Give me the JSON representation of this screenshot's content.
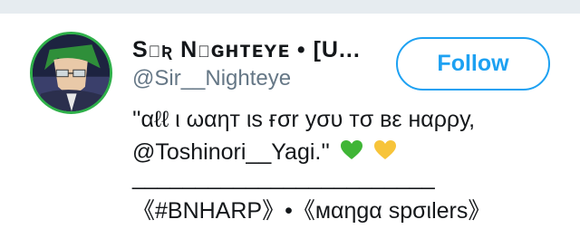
{
  "profile": {
    "display_name": "Sɪʀ Nɪɢʜᴛᴇʏᴇ • [U...",
    "handle": "@Sir__Nighteye",
    "follow_label": "Follow",
    "bio_line1": "''αℓℓ ι ωαηт ιѕ ғσr уσυ тσ вε нαρρу,",
    "bio_line2": "@Toshinori__Yagi.''",
    "bio_emoji": [
      "green-heart-icon",
      "yellow-heart-icon"
    ],
    "divider": "________________________",
    "tags": "《#BNHARP》•《мαηgα spσιlers》"
  },
  "colors": {
    "accent": "#1da1f2",
    "secondary_text": "#657786",
    "avatar_ring": "#2fb04a"
  }
}
